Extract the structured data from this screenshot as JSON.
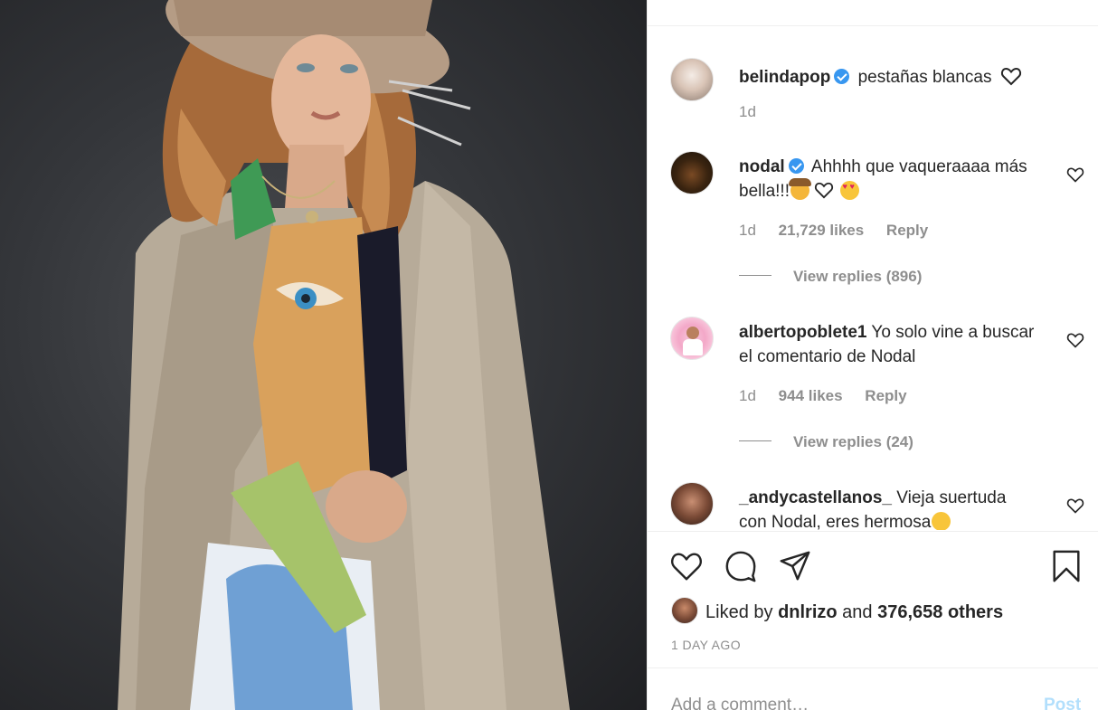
{
  "post": {
    "author": "belindapop",
    "caption": "pestañas blancas",
    "caption_time": "1d",
    "icons": {
      "caption_heart": "heart-outline-icon",
      "verified": "verified-badge-icon"
    }
  },
  "comments": [
    {
      "username": "nodal",
      "verified": true,
      "text": "Ahhhh que vaqueraaaa más bella!!!",
      "emojis": [
        "cowboy-emoji",
        "white-heart-emoji",
        "heart-eyes-emoji"
      ],
      "time": "1d",
      "likes": "21,729 likes",
      "reply_label": "Reply",
      "view_replies": "View replies (896)"
    },
    {
      "username": "albertopoblete1",
      "verified": false,
      "text": "Yo solo vine a buscar el comentario de Nodal",
      "time": "1d",
      "likes": "944 likes",
      "reply_label": "Reply",
      "view_replies": "View replies (24)"
    },
    {
      "username": "_andycastellanos_",
      "verified": false,
      "text": "Vieja suertuda con Nodal, eres hermosa",
      "emojis": [
        "smiling-blush-emoji"
      ]
    }
  ],
  "actions": {
    "icons": [
      "heart-icon",
      "comment-icon",
      "share-icon",
      "bookmark-icon"
    ],
    "liked_by_prefix": "Liked by",
    "liked_by_user": "dnlrizo",
    "liked_by_and": "and",
    "liked_by_others": "376,658 others",
    "time_ago": "1 DAY AGO"
  },
  "add_comment": {
    "placeholder": "Add a comment…",
    "post_label": "Post"
  },
  "colors": {
    "verified_blue": "#3897f0",
    "muted_text": "#8e8e8e",
    "post_disabled": "#b2dffc",
    "divider": "#efefef"
  }
}
